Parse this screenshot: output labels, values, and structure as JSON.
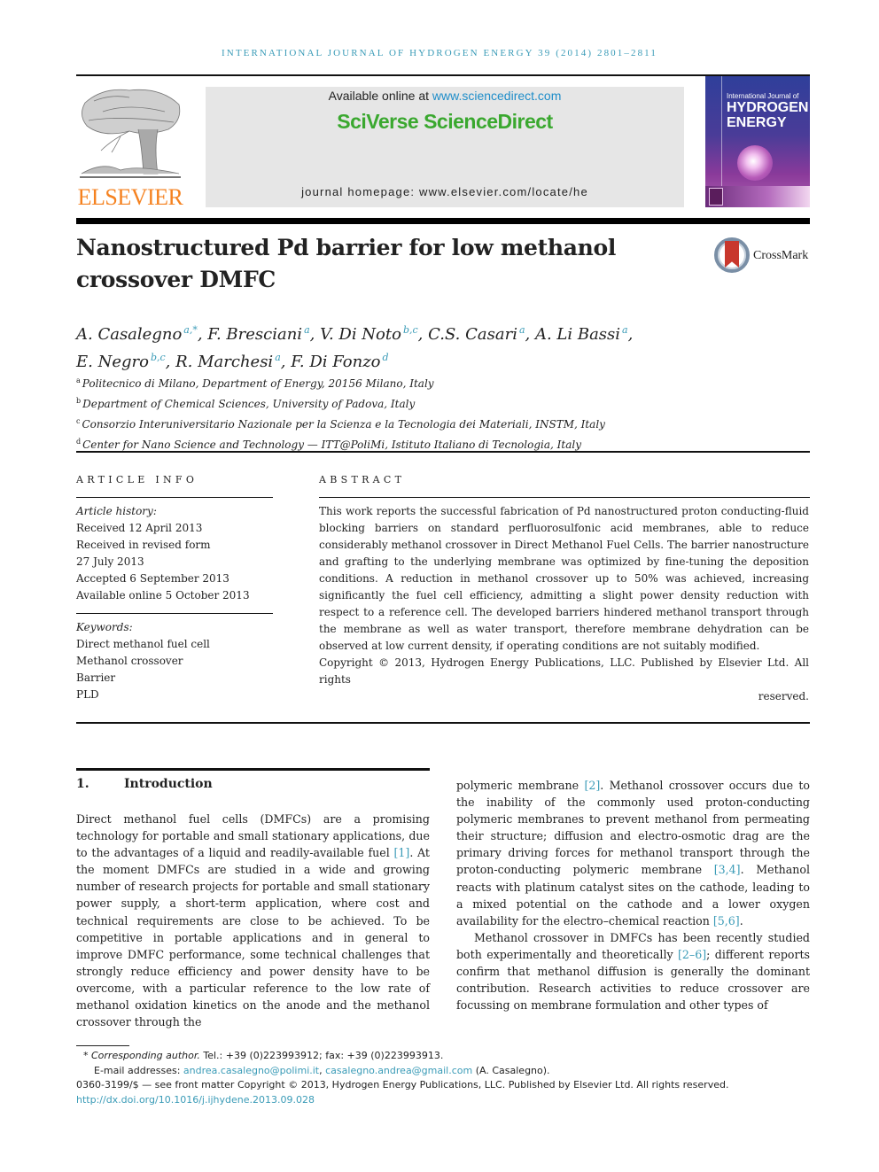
{
  "running_head": "INTERNATIONAL JOURNAL OF HYDROGEN ENERGY 39 (2014) 2801–2811",
  "publisher": {
    "logo_word": "ELSEVIER",
    "available_prefix": "Available online at ",
    "available_link": "www.sciencedirect.com",
    "brand": "SciVerse ScienceDirect",
    "homepage_prefix": "journal homepage: ",
    "homepage_url": "www.elsevier.com/locate/he",
    "colors": {
      "elsevier_orange": "#f58220",
      "sd_green": "#3aa82f",
      "link_blue": "#1e8dc9",
      "ref_blue": "#3a9bb7"
    }
  },
  "cover": {
    "line1": "International Journal of",
    "line2": "HYDROGEN",
    "line3": "ENERGY"
  },
  "crossmark_label": "CrossMark",
  "article": {
    "title_line1": "Nanostructured Pd barrier for low methanol",
    "title_line2": "crossover DMFC",
    "authors": [
      {
        "name": "A. Casalegno",
        "aff": "a,*"
      },
      {
        "name": "F. Bresciani",
        "aff": "a"
      },
      {
        "name": "V. Di Noto",
        "aff": "b,c"
      },
      {
        "name": "C.S. Casari",
        "aff": "a"
      },
      {
        "name": "A. Li Bassi",
        "aff": "a"
      },
      {
        "name": "E. Negro",
        "aff": "b,c"
      },
      {
        "name": "R. Marchesi",
        "aff": "a"
      },
      {
        "name": "F. Di Fonzo",
        "aff": "d"
      }
    ],
    "affiliations": [
      {
        "key": "a",
        "text": "Politecnico di Milano, Department of Energy, 20156 Milano, Italy"
      },
      {
        "key": "b",
        "text": "Department of Chemical Sciences, University of Padova, Italy"
      },
      {
        "key": "c",
        "text": "Consorzio Interuniversitario Nazionale per la Scienza e la Tecnologia dei Materiali, INSTM, Italy"
      },
      {
        "key": "d",
        "text": "Center for Nano Science and Technology — ITT@PoliMi, Istituto Italiano di Tecnologia, Italy"
      }
    ]
  },
  "article_info": {
    "heading": "ARTICLE INFO",
    "history_label": "Article history:",
    "history": [
      "Received 12 April 2013",
      "Received in revised form",
      "27 July 2013",
      "Accepted 6 September 2013",
      "Available online 5 October 2013"
    ],
    "keywords_label": "Keywords:",
    "keywords": [
      "Direct methanol fuel cell",
      "Methanol crossover",
      "Barrier",
      "PLD"
    ]
  },
  "abstract": {
    "heading": "ABSTRACT",
    "text": "This work reports the successful fabrication of Pd nanostructured proton conducting-fluid blocking barriers on standard perfluorosulfonic acid membranes, able to reduce considerably methanol crossover in Direct Methanol Fuel Cells. The barrier nanostructure and grafting to the underlying membrane was optimized by fine-tuning the deposition conditions. A reduction in methanol crossover up to 50% was achieved, increasing significantly the fuel cell efficiency, admitting a slight power density reduction with respect to a reference cell. The developed barriers hindered methanol transport through the membrane as well as water transport, therefore membrane dehydration can be observed at low current density, if operating conditions are not suitably modified.",
    "copyright_main": "Copyright © 2013, Hydrogen Energy Publications, LLC. Published by Elsevier Ltd. All rights",
    "copyright_end": "reserved."
  },
  "intro": {
    "number": "1.",
    "heading": "Introduction",
    "left_col": {
      "p1a": "Direct methanol fuel cells (DMFCs) are a promising technology for portable and small stationary applications, due to the advantages of a liquid and readily-available fuel ",
      "ref1": "[1]",
      "p1b": ". At the moment DMFCs are studied in a wide and growing number of research projects for portable and small stationary power supply, a short-term application, where cost and technical requirements are close to be achieved. To be competitive in portable applications and in general to improve DMFC performance, some technical challenges that strongly reduce efficiency and power density have to be overcome, with a particular reference to the low rate of methanol oxidation kinetics on the anode and the methanol crossover through the"
    },
    "right_col": {
      "s1": "polymeric membrane ",
      "ref2": "[2]",
      "s2": ". Methanol crossover occurs due to the inability of the commonly used proton-conducting polymeric membranes to prevent methanol from permeating their structure; diffusion and electro-osmotic drag are the primary driving forces for methanol transport through the proton-conducting polymeric membrane ",
      "ref34": "[3,4]",
      "s3": ". Methanol reacts with platinum catalyst sites on the cathode, leading to a mixed potential on the cathode and a lower oxygen availability for the electro–chemical reaction ",
      "ref56": "[5,6]",
      "s4": ".",
      "p2a": "Methanol crossover in DMFCs has been recently studied both experimentally and theoretically ",
      "ref26": "[2–6]",
      "p2b": "; different reports confirm that methanol diffusion is generally the dominant contribution. Research activities to reduce crossover are focussing on membrane formulation and other types of"
    }
  },
  "footnotes": {
    "star": "*",
    "corr_label": "Corresponding author.",
    "corr_text": " Tel.: +39 (0)223993912; fax: +39 (0)223993913.",
    "email_label": "E-mail addresses: ",
    "email1": "andrea.casalegno@polimi.it",
    "sep": ", ",
    "email2": "casalegno.andrea@gmail.com",
    "email_owner": " (A. Casalegno).",
    "issn_line": "0360-3199/$ — see front matter Copyright © 2013, Hydrogen Energy Publications, LLC. Published by Elsevier Ltd. All rights reserved.",
    "doi": "http://dx.doi.org/10.1016/j.ijhydene.2013.09.028"
  }
}
